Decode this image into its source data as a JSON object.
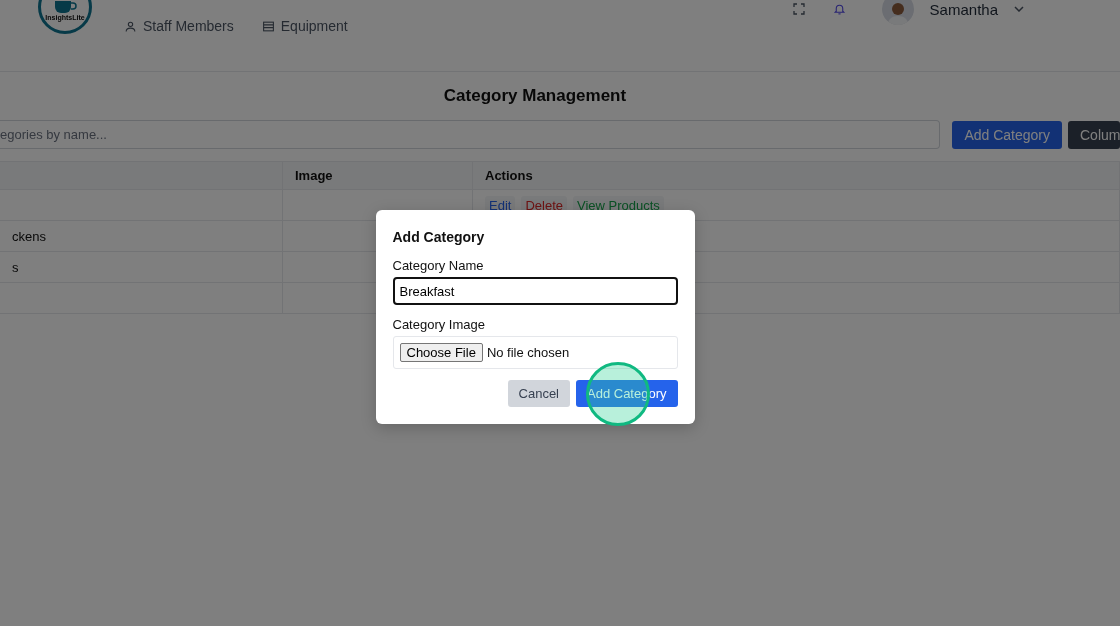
{
  "header": {
    "logo_text": "InsightsLite",
    "nav": [
      {
        "label": "Staff Members",
        "kind": "user"
      },
      {
        "label": "Equipment",
        "kind": "list"
      }
    ],
    "user_name": "Samantha"
  },
  "page": {
    "title": "Category Management"
  },
  "toolbar": {
    "search_placeholder": "egories by name...",
    "buttons": [
      {
        "label": "Add Category",
        "kind": "primary"
      },
      {
        "label": "Colum",
        "kind": "dark"
      }
    ]
  },
  "table": {
    "columns": [
      "",
      "Image",
      "Actions"
    ],
    "rows": [
      {
        "name": "",
        "actions": [
          {
            "label": "Edit",
            "kind": "edit"
          },
          {
            "label": "Delete",
            "kind": "delete"
          },
          {
            "label": "View Products",
            "kind": "view"
          }
        ]
      },
      {
        "name": "ckens",
        "actions": []
      },
      {
        "name": "s",
        "actions": []
      },
      {
        "name": "",
        "actions": []
      }
    ]
  },
  "modal": {
    "title": "Add Category",
    "name_label": "Category Name",
    "name_value": "Breakfast",
    "image_label": "Category Image",
    "file_button": "Choose File",
    "file_status": "No file chosen",
    "buttons": [
      {
        "label": "Cancel",
        "kind": "secondary"
      },
      {
        "label": "Add Category",
        "kind": "primary"
      }
    ]
  }
}
